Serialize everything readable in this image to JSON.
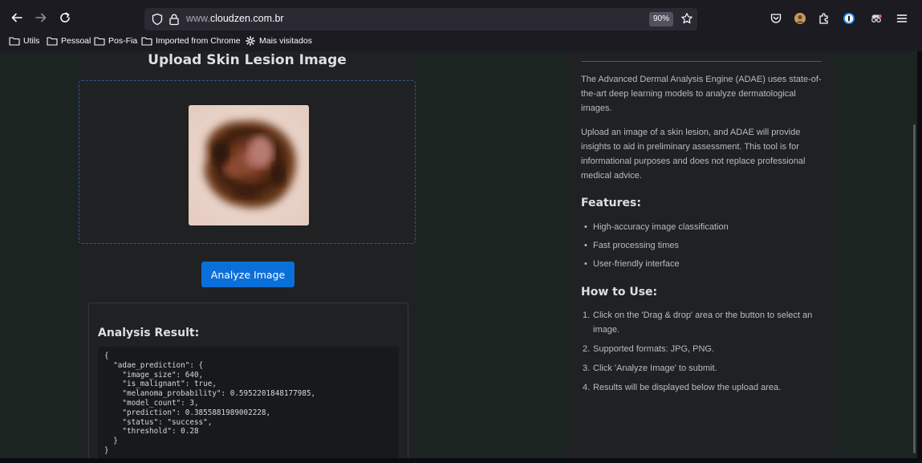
{
  "browser": {
    "url_host": "www.",
    "url_domain": "cloudzen.com.br",
    "zoom": "90%",
    "bookmarks": [
      {
        "label": "Utils"
      },
      {
        "label": "Pessoal"
      },
      {
        "label": "Pos-Fia"
      },
      {
        "label": "Imported from Chrome"
      },
      {
        "label": "Mais visitados"
      }
    ]
  },
  "upload": {
    "title": "Upload Skin Lesion Image",
    "button_label": "Analyze Image"
  },
  "result": {
    "title": "Analysis Result:",
    "json_lines": [
      "{",
      "  \"adae_prediction\": {",
      "    \"image_size\": 640,",
      "    \"is_malignant\": true,",
      "    \"melanoma_probability\": 0.5952201848177985,",
      "    \"model_count\": 3,",
      "    \"prediction\": 0.3855881989002228,",
      "    \"status\": \"success\",",
      "    \"threshold\": 0.28",
      "  }",
      "}"
    ]
  },
  "about": {
    "description_1": "The Advanced Dermal Analysis Engine (ADAE) uses state-of-the-art deep learning models to analyze dermatological images.",
    "description_2": "Upload an image of a skin lesion, and ADAE will provide insights to aid in preliminary assessment. This tool is for informational purposes and does not replace professional medical advice.",
    "features_title": "Features:",
    "features": [
      "High-accuracy image classification",
      "Fast processing times",
      "User-friendly interface"
    ],
    "howto_title": "How to Use:",
    "howto": [
      {
        "num": "1.",
        "text": "Click on the 'Drag & drop' area or the button to select an image."
      },
      {
        "num": "2.",
        "text": "Supported formats: JPG, PNG."
      },
      {
        "num": "3.",
        "text": "Click 'Analyze Image' to submit."
      },
      {
        "num": "4.",
        "text": "Results will be displayed below the upload area."
      }
    ]
  }
}
